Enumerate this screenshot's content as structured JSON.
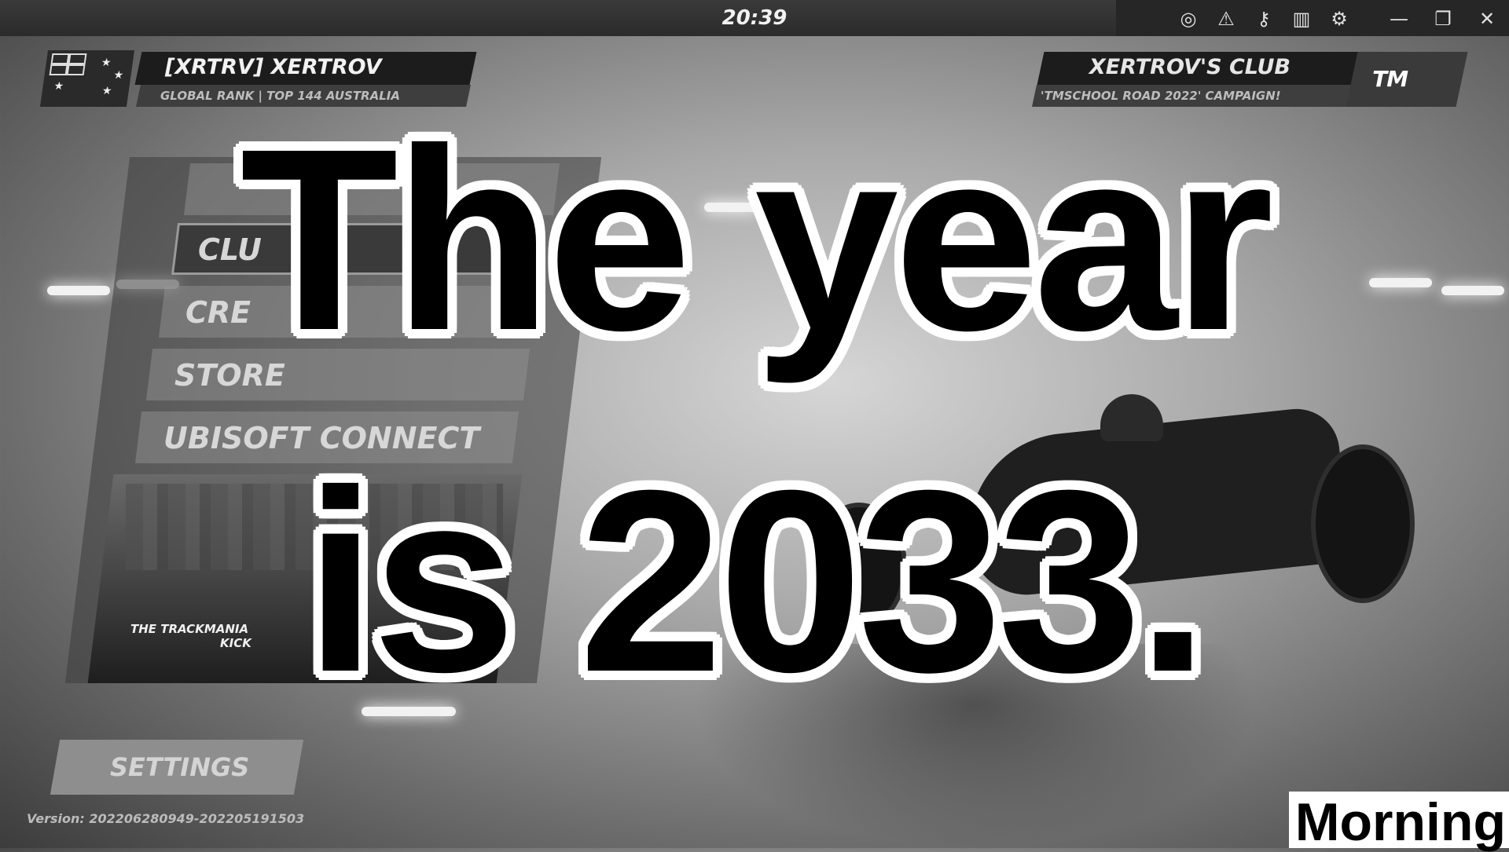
{
  "topbar": {
    "clock": "20:39",
    "icons": [
      "ubisoft-swirl-icon",
      "warning-icon",
      "key-icon",
      "audio-levels-icon",
      "settings-gear-icon"
    ],
    "window_controls": [
      "minimize-icon",
      "restore-icon",
      "close-icon"
    ]
  },
  "player": {
    "name": "[XRTRV] XERTROV",
    "rank": "GLOBAL RANK | TOP 144 AUSTRALIA",
    "flag": "australia-flag"
  },
  "club": {
    "name": "XERTROV'S CLUB",
    "campaign": "'TMSCHOOL ROAD 2022' CAMPAIGN!",
    "logo_text": "TM"
  },
  "menu": {
    "items": [
      {
        "label": "CLU"
      },
      {
        "label": "CRE"
      },
      {
        "label": "STORE"
      },
      {
        "label": "UBISOFT CONNECT"
      }
    ],
    "news_line1": "THE TRACKMANIA",
    "news_line2": "KICK"
  },
  "settings": {
    "label": "SETTINGS"
  },
  "version": "Version: 202206280949-202205191503",
  "overlay": {
    "line1": "The year",
    "line2": "is 2033.",
    "corner_label": "Morning"
  }
}
